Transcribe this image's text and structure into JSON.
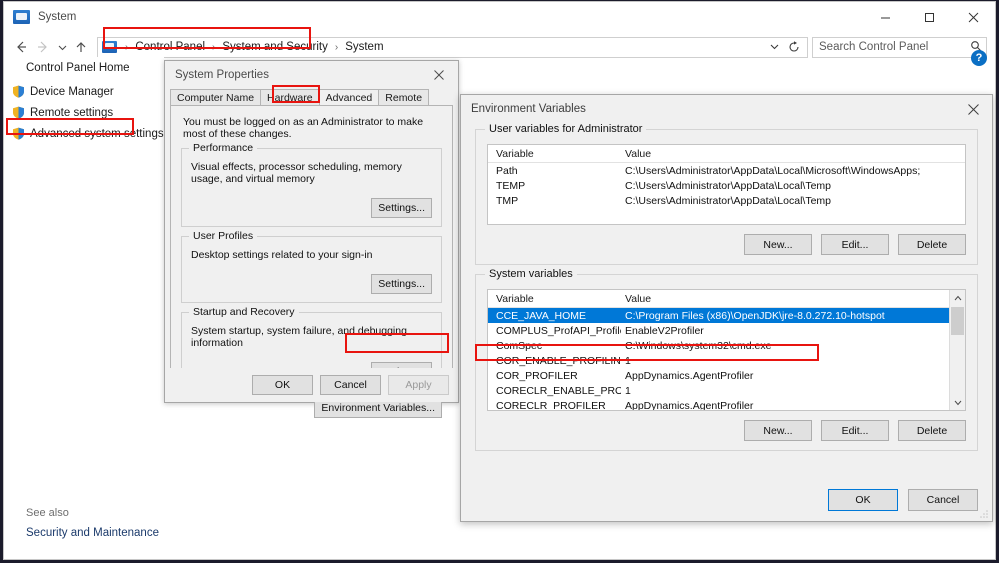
{
  "window": {
    "title": "System",
    "icon": "system-icon",
    "minimize": "–",
    "maximize": "□",
    "close": "×"
  },
  "toolbar": {
    "back": "←",
    "forward": "→",
    "recent": "⌄",
    "up": "↑",
    "address_icon": "control-panel-icon",
    "breadcrumbs": [
      "Control Panel",
      "System and Security",
      "System"
    ],
    "separator": "›",
    "dropdown": "⌄",
    "refresh": "↻",
    "search_placeholder": "Search Control Panel",
    "search_icon": "search-icon",
    "help_label": "?"
  },
  "sidebar": {
    "home": "Control Panel Home",
    "items": [
      {
        "label": "Device Manager",
        "icon": "shield-icon"
      },
      {
        "label": "Remote settings",
        "icon": "shield-icon"
      },
      {
        "label": "Advanced system settings",
        "icon": "shield-icon"
      }
    ],
    "see_also_label": "See also",
    "see_also_link": "Security and Maintenance"
  },
  "system_properties": {
    "title": "System Properties",
    "close": "×",
    "tabs": [
      {
        "label": "Computer Name",
        "active": false
      },
      {
        "label": "Hardware",
        "active": false
      },
      {
        "label": "Advanced",
        "active": true
      },
      {
        "label": "Remote",
        "active": false
      }
    ],
    "note": "You must be logged on as an Administrator to make most of these changes.",
    "groups": [
      {
        "label": "Performance",
        "text": "Visual effects, processor scheduling, memory usage, and virtual memory",
        "button": "Settings..."
      },
      {
        "label": "User Profiles",
        "text": "Desktop settings related to your sign-in",
        "button": "Settings..."
      },
      {
        "label": "Startup and Recovery",
        "text": "System startup, system failure, and debugging information",
        "button": "Settings..."
      }
    ],
    "env_button": "Environment Variables...",
    "footer": {
      "ok": "OK",
      "cancel": "Cancel",
      "apply": "Apply"
    }
  },
  "environment_variables": {
    "title": "Environment Variables",
    "close": "×",
    "user_section": {
      "label": "User variables for Administrator",
      "columns": [
        "Variable",
        "Value"
      ],
      "rows": [
        {
          "variable": "Path",
          "value": "C:\\Users\\Administrator\\AppData\\Local\\Microsoft\\WindowsApps;",
          "selected": false
        },
        {
          "variable": "TEMP",
          "value": "C:\\Users\\Administrator\\AppData\\Local\\Temp",
          "selected": false
        },
        {
          "variable": "TMP",
          "value": "C:\\Users\\Administrator\\AppData\\Local\\Temp",
          "selected": false
        }
      ],
      "buttons": {
        "new": "New...",
        "edit": "Edit...",
        "delete": "Delete"
      }
    },
    "system_section": {
      "label": "System variables",
      "columns": [
        "Variable",
        "Value"
      ],
      "rows": [
        {
          "variable": "CCE_JAVA_HOME",
          "value": "C:\\Program Files (x86)\\OpenJDK\\jre-8.0.272.10-hotspot",
          "selected": true
        },
        {
          "variable": "COMPLUS_ProfAPI_ProfilerC...",
          "value": "EnableV2Profiler",
          "selected": false
        },
        {
          "variable": "ComSpec",
          "value": "C:\\Windows\\system32\\cmd.exe",
          "selected": false
        },
        {
          "variable": "COR_ENABLE_PROFILING",
          "value": "1",
          "selected": false
        },
        {
          "variable": "COR_PROFILER",
          "value": "AppDynamics.AgentProfiler",
          "selected": false
        },
        {
          "variable": "CORECLR_ENABLE_PROFILI...",
          "value": "1",
          "selected": false
        },
        {
          "variable": "CORECLR_PROFILER",
          "value": "AppDynamics.AgentProfiler",
          "selected": false
        }
      ],
      "buttons": {
        "new": "New...",
        "edit": "Edit...",
        "delete": "Delete"
      },
      "scroll_up": "⌃",
      "scroll_down": "⌄"
    },
    "footer": {
      "ok": "OK",
      "cancel": "Cancel"
    }
  },
  "annotations": {
    "color": "#e8140f",
    "boxes": [
      "breadcrumb-highlight",
      "advanced-system-settings-highlight",
      "advanced-tab-highlight",
      "environment-variables-button-highlight",
      "selected-variable-row-highlight"
    ]
  }
}
